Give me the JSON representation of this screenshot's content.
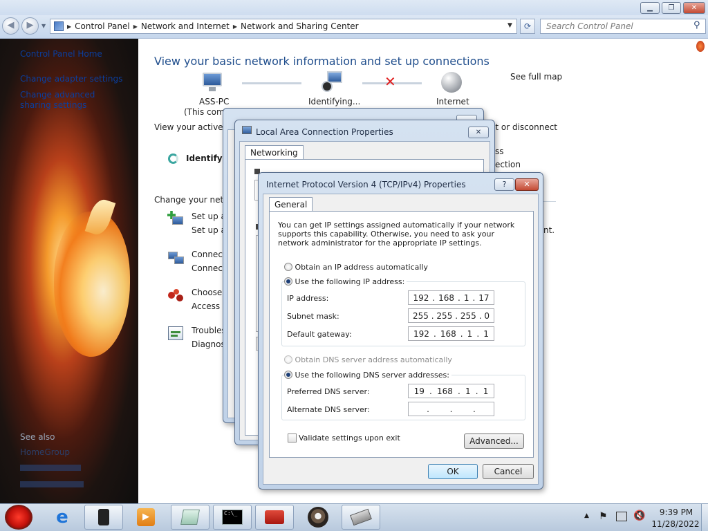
{
  "breadcrumb": [
    "Control Panel",
    "Network and Internet",
    "Network and Sharing Center"
  ],
  "search_placeholder": "Search Control Panel",
  "sidebar": {
    "home": "Control Panel Home",
    "items": [
      "Change adapter settings",
      "Change advanced sharing settings"
    ],
    "see_also": "See also",
    "see_also_items": [
      "HomeGroup"
    ]
  },
  "main": {
    "title": "View your basic network information and set up connections",
    "see_full_map": "See full map",
    "nodes": {
      "pc": "ASS-PC",
      "pc_sub": "(This computer)",
      "middle": "Identifying...",
      "internet": "Internet"
    },
    "active_networks": "View your active networks",
    "identifying": "Identifying...",
    "connect_disconnect": "Connect or disconnect",
    "access_type_frag": "ss",
    "connection_frag": "ection",
    "change_settings": "Change your networking settings",
    "tasks": [
      {
        "title": "Set up a",
        "desc": "Set up a"
      },
      {
        "title": "Connect",
        "desc": "Connect"
      },
      {
        "title": "Choose h",
        "desc": "Access fi"
      },
      {
        "title": "Troubles",
        "desc": "Diagnose"
      }
    ],
    "trailing_frag": "nt."
  },
  "dlg_lac": {
    "title": "Local Area Connection Properties",
    "tab": "Networking"
  },
  "ipv4": {
    "title": "Internet Protocol Version 4 (TCP/IPv4) Properties",
    "tab": "General",
    "intro": "You can get IP settings assigned automatically if your network supports this capability. Otherwise, you need to ask your network administrator for the appropriate IP settings.",
    "obtain_ip": "Obtain an IP address automatically",
    "use_ip": "Use the following IP address:",
    "ip_label": "IP address:",
    "ip": [
      "192",
      "168",
      "1",
      "17"
    ],
    "mask_label": "Subnet mask:",
    "mask": [
      "255",
      "255",
      "255",
      "0"
    ],
    "gw_label": "Default gateway:",
    "gw": [
      "192",
      "168",
      "1",
      "1"
    ],
    "obtain_dns": "Obtain DNS server address automatically",
    "use_dns": "Use the following DNS server addresses:",
    "pref_label": "Preferred DNS server:",
    "pref": [
      "19",
      "168",
      "1",
      "1"
    ],
    "alt_label": "Alternate DNS server:",
    "alt": [
      "",
      "",
      "",
      ""
    ],
    "validate": "Validate settings upon exit",
    "advanced": "Advanced...",
    "ok": "OK",
    "cancel": "Cancel",
    "help_glyph": "?",
    "close_glyph": "✕"
  },
  "tray": {
    "time": "9:39 PM",
    "date": "11/28/2022"
  },
  "colors": {
    "link": "#0b56b8",
    "title": "#1f4d8c",
    "error": "#e02020"
  }
}
